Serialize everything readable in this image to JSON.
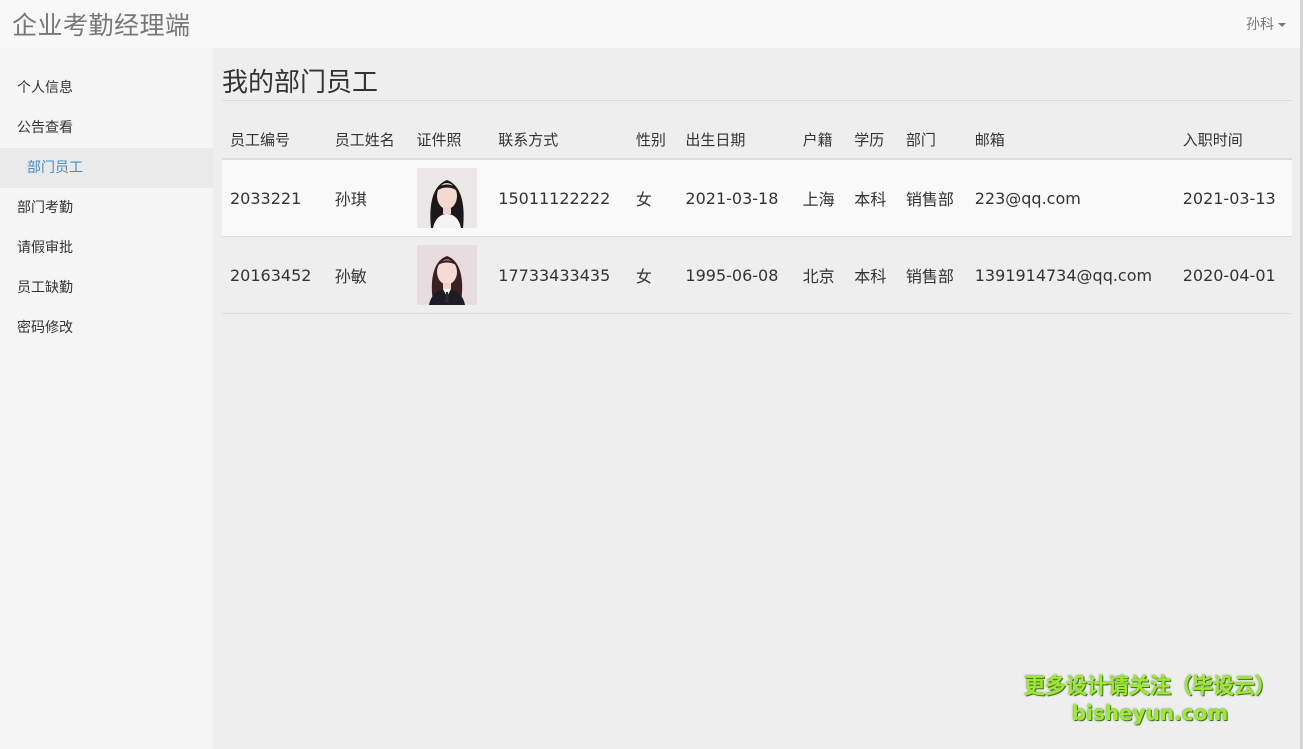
{
  "app": {
    "brand": "企业考勤经理端",
    "user": "孙科"
  },
  "sidebar": {
    "items": [
      {
        "label": "个人信息",
        "active": false
      },
      {
        "label": "公告查看",
        "active": false
      },
      {
        "label": "部门员工",
        "active": true
      },
      {
        "label": "部门考勤",
        "active": false
      },
      {
        "label": "请假审批",
        "active": false
      },
      {
        "label": "员工缺勤",
        "active": false
      },
      {
        "label": "密码修改",
        "active": false
      }
    ]
  },
  "main": {
    "title": "我的部门员工",
    "table": {
      "headers": [
        "员工编号",
        "员工姓名",
        "证件照",
        "联系方式",
        "性别",
        "出生日期",
        "户籍",
        "学历",
        "部门",
        "邮箱",
        "入职时间"
      ],
      "rows": [
        {
          "id": "2033221",
          "name": "孙琪",
          "photo": "id-photo",
          "phone": "15011122222",
          "gender": "女",
          "birth": "2021-03-18",
          "hukou": "上海",
          "edu": "本科",
          "dept": "销售部",
          "email": "223@qq.com",
          "joined": "2021-03-13"
        },
        {
          "id": "20163452",
          "name": "孙敏",
          "photo": "id-photo",
          "phone": "17733433435",
          "gender": "女",
          "birth": "1995-06-08",
          "hukou": "北京",
          "edu": "本科",
          "dept": "销售部",
          "email": "1391914734@qq.com",
          "joined": "2020-04-01"
        }
      ]
    }
  },
  "watermark": {
    "line1": "更多设计请关注（毕设云）",
    "line2": "bisheyun.com"
  },
  "colors": {
    "active_link": "#428bca",
    "watermark": "#a3e635"
  }
}
